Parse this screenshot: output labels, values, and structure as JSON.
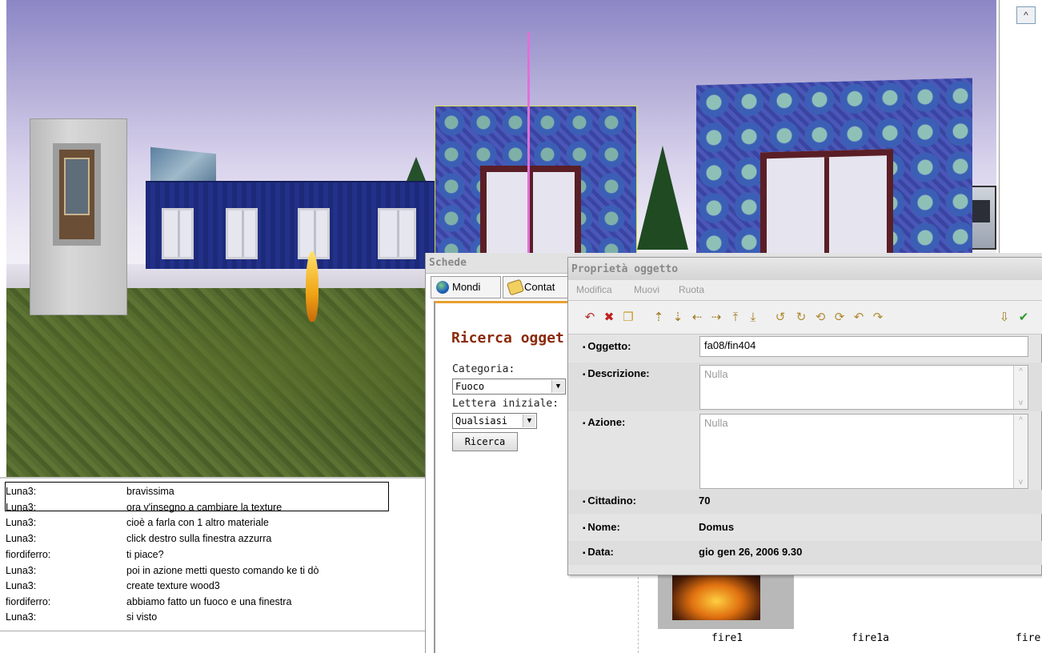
{
  "chat": {
    "messages": [
      {
        "who": "Luna3:",
        "msg": "bravissima"
      },
      {
        "who": "Luna3:",
        "msg": "ora v'insegno a cambiare la texture"
      },
      {
        "who": "Luna3:",
        "msg": "cioè a farla con 1 altro materiale"
      },
      {
        "who": "Luna3:",
        "msg": "click destro sulla finestra azzurra"
      },
      {
        "who": "fiordiferro:",
        "msg": "ti piace?"
      },
      {
        "who": "Luna3:",
        "msg": "poi in azione metti questo comando ke ti dò"
      },
      {
        "who": "Luna3:",
        "msg": "create texture wood3"
      },
      {
        "who": "fiordiferro:",
        "msg": "abbiamo fatto un fuoco e una finestra"
      },
      {
        "who": "Luna3:",
        "msg": "si visto"
      }
    ]
  },
  "schede": {
    "title": "Schede",
    "tabs": [
      {
        "label": "Mondi",
        "icon": "globe-icon"
      },
      {
        "label": "Contat",
        "icon": "contacts-icon"
      }
    ],
    "search": {
      "title": "Ricerca ogget",
      "category_label": "Categoria:",
      "category_value": "Fuoco",
      "letter_label": "Lettera iniziale:",
      "letter_value": "Qualsiasi",
      "button": "Ricerca"
    },
    "results": [
      "fire1",
      "fire1a",
      "fire"
    ]
  },
  "props": {
    "title": "Proprietà oggetto",
    "menu": [
      "Modifica",
      "Muovi",
      "Ruota"
    ],
    "fields": {
      "oggetto_label": "Oggetto:",
      "oggetto_value": "fa08/fin404",
      "descrizione_label": "Descrizione:",
      "descrizione_value": "Nulla",
      "azione_label": "Azione:",
      "azione_value": "Nulla",
      "cittadino_label": "Cittadino:",
      "cittadino_value": "70",
      "nome_label": "Nome:",
      "nome_value": "Domus",
      "data_label": "Data:",
      "data_value": "gio gen 26, 2006 9.30"
    },
    "toolbar_icons": [
      "undo-icon",
      "delete-icon",
      "duplicate-icon",
      "move-up-icon",
      "move-down-icon",
      "move-left-icon",
      "move-right-icon",
      "raise-icon",
      "lower-icon",
      "rotate-left-icon",
      "rotate-right-icon",
      "tilt-forward-icon",
      "tilt-back-icon",
      "roll-left-icon",
      "roll-right-icon",
      "snap-icon",
      "select-icon"
    ]
  },
  "colors": {
    "search_title": "#8b2a0a",
    "tab_accent": "#e8a030"
  }
}
